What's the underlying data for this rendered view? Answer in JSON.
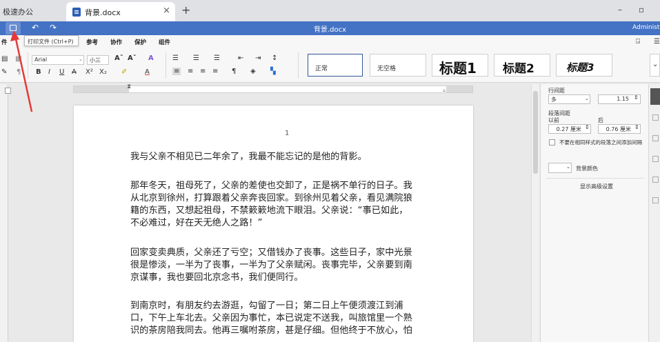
{
  "browser": {
    "inactive_tab": "极速办公",
    "active_tab": "背景.docx",
    "close_symbol": "×",
    "new_tab": "+",
    "minimize": "–",
    "restore": "▫"
  },
  "app": {
    "title": "背景.docx",
    "user": "Administrat",
    "tooltip": "打印文件 (Ctrl+P)"
  },
  "menu": [
    "件",
    "页",
    "参考",
    "协作",
    "保护",
    "组件"
  ],
  "ribbon": {
    "font_name": "Arial",
    "font_size": "小三",
    "styles": [
      "正常",
      "无空格",
      "标题1",
      "标题2",
      "标题3"
    ]
  },
  "document": {
    "page_number": "1",
    "paragraphs": [
      [
        "我与父亲不相见已二年余了，我最不能忘记的是他的背影。"
      ],
      [
        "那年冬天，祖母死了，父亲的差使也交卸了，正是祸不单行的日子。我",
        "从北京到徐州，打算跟着父亲奔丧回家。到徐州见着父亲，看见满院狼",
        "籍的东西，又想起祖母，不禁簌簌地流下眼泪。父亲说：“事已如此，",
        "不必难过，好在天无绝人之路！”"
      ],
      [
        "回家变卖典质，父亲还了亏空；又借钱办了丧事。这些日子，家中光景",
        "很是惨淡，一半为了丧事，一半为了父亲赋闲。丧事完毕，父亲要到南",
        "京谋事，我也要回北京念书，我们便同行。"
      ],
      [
        "到南京时，有朋友约去游逛，勾留了一日；第二日上午便须渡江到浦",
        "口，下午上车北去。父亲因为事忙，本已说定不送我，叫旅馆里一个熟",
        "识的茶房陪我同去。他再三嘱咐茶房，甚是仔细。但他终于不放心，怕"
      ]
    ]
  },
  "panel": {
    "line_spacing_label": "行间距",
    "line_spacing_mode": "多",
    "line_spacing_value": "1.15",
    "para_spacing_label": "段落间距",
    "before_label": "以前",
    "after_label": "后",
    "before_value": "0.27 厘米",
    "after_value": "0.76 厘米",
    "no_space_label": "不要在相同样式的段落之间添加间隔",
    "bg_color_label": "背景颜色",
    "advanced_link": "显示高级设置"
  },
  "colors": {
    "app_bar": "#4472c4",
    "annotation_arrow": "#e53935"
  }
}
